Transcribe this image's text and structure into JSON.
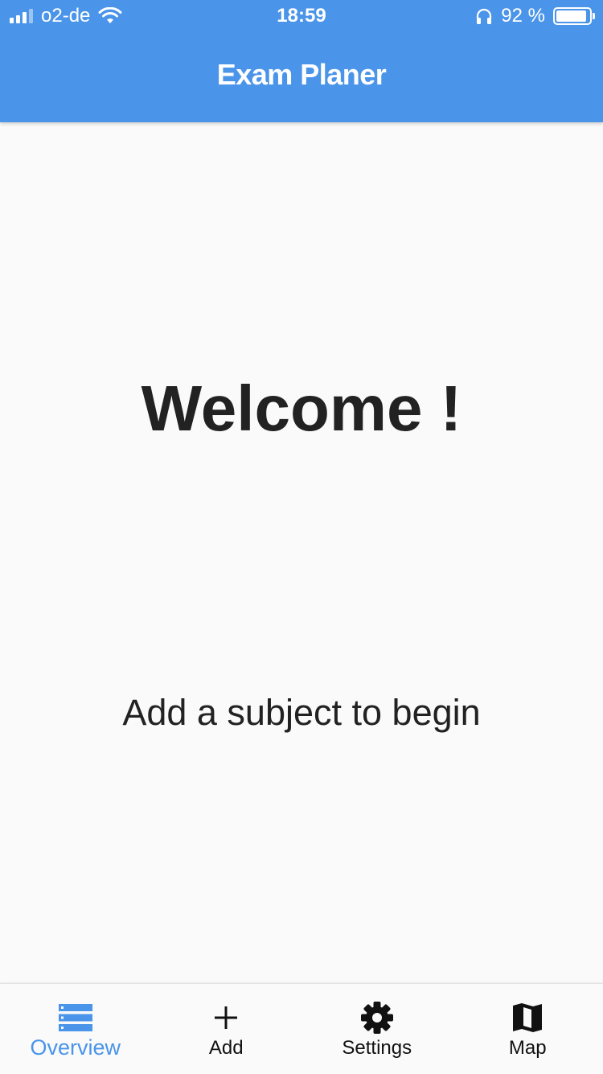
{
  "status_bar": {
    "carrier": "o2-de",
    "time": "18:59",
    "battery_percent": "92 %",
    "battery_level": 0.92
  },
  "app_bar": {
    "title": "Exam Planer"
  },
  "main": {
    "welcome": "Welcome !",
    "hint": "Add a subject to begin"
  },
  "bottom_nav": {
    "items": [
      {
        "label": "Overview",
        "icon": "list-icon",
        "active": true
      },
      {
        "label": "Add",
        "icon": "plus-icon",
        "active": false
      },
      {
        "label": "Settings",
        "icon": "gear-icon",
        "active": false
      },
      {
        "label": "Map",
        "icon": "map-icon",
        "active": false
      }
    ]
  },
  "colors": {
    "primary": "#4a94e9",
    "background": "#fafafa",
    "text": "#222222"
  }
}
